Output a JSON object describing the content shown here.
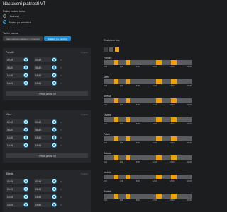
{
  "title": "Nastavení platnosti VT",
  "mode_label": "Režim zadání tarifu",
  "mode_options": [
    "Hodinový",
    "Pásma po minutách"
  ],
  "bands_label": "Tarifní pásma",
  "copy_button": "Naformátovat nastavení z minulosti",
  "reset_button": "Nastavit pro všechny",
  "delete_label": "Smazat",
  "add_label": "+ Přidat pásmo VT",
  "days": [
    {
      "name": "Pondělí",
      "rows": [
        [
          "02:45",
          "03:45"
        ],
        [
          "06:30",
          "06:45"
        ],
        [
          "14:45",
          "15:45"
        ],
        [
          "18:45",
          "19:45"
        ]
      ]
    },
    {
      "name": "Úterý",
      "rows": [
        [
          "02:45",
          "03:45"
        ],
        [
          "06:30",
          "06:45"
        ],
        [
          "14:45",
          "15:45"
        ],
        [
          "18:45",
          "19:45"
        ]
      ]
    },
    {
      "name": "Středa",
      "rows": [
        [
          "02:45",
          "03:45"
        ],
        [
          "06:30",
          "06:45"
        ],
        [
          "14:45",
          "15:45"
        ],
        [
          "18:45",
          "19:45"
        ]
      ]
    }
  ],
  "right": {
    "label": "Rozložení dne",
    "ticks": [
      "0:00",
      "4:00",
      "8:00",
      "12:00",
      "16:00",
      "20:00"
    ],
    "days": [
      "Pondělí",
      "Úterý",
      "Středa",
      "Čtvrtek",
      "Pátek",
      "Sobota",
      "Neděle",
      "Svátek"
    ]
  },
  "colors": {
    "accent": "#1f8bd0",
    "tariff": "#f0a000",
    "bg": "#1c1d1f"
  }
}
